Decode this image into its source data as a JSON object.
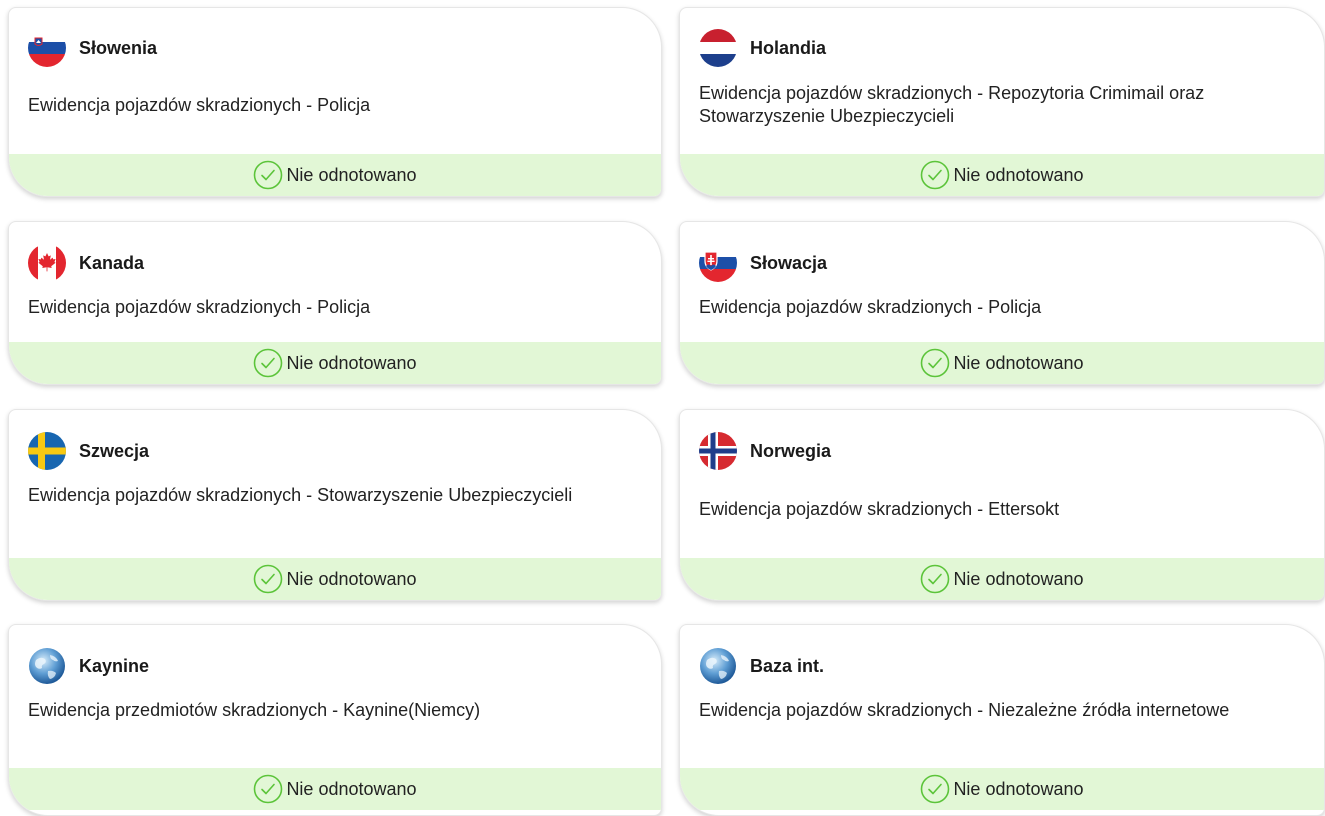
{
  "colors": {
    "status_bg": "#e2f7d6",
    "check_green": "#5cc43a",
    "card_border": "#e6e6e6"
  },
  "cards": [
    {
      "country": "Słowenia",
      "flag_icon": "slovenia-flag-icon",
      "description": "Ewidencja pojazdów skradzionych - Policja",
      "status": "Nie odnotowano"
    },
    {
      "country": "Holandia",
      "flag_icon": "netherlands-flag-icon",
      "description": "Ewidencja pojazdów skradzionych - Repozytoria Crimimail oraz Stowarzyszenie Ubezpieczycieli",
      "status": "Nie odnotowano"
    },
    {
      "country": "Kanada",
      "flag_icon": "canada-flag-icon",
      "description": "Ewidencja pojazdów skradzionych - Policja",
      "status": "Nie odnotowano"
    },
    {
      "country": "Słowacja",
      "flag_icon": "slovakia-flag-icon",
      "description": "Ewidencja pojazdów skradzionych - Policja",
      "status": "Nie odnotowano"
    },
    {
      "country": "Szwecja",
      "flag_icon": "sweden-flag-icon",
      "description": "Ewidencja pojazdów skradzionych - Stowarzyszenie Ubezpieczycieli",
      "status": "Nie odnotowano"
    },
    {
      "country": "Norwegia",
      "flag_icon": "norway-flag-icon",
      "description": "Ewidencja pojazdów skradzionych - Ettersokt",
      "status": "Nie odnotowano"
    },
    {
      "country": "Kaynine",
      "flag_icon": "globe-icon",
      "description": "Ewidencja przedmiotów skradzionych - Kaynine(Niemcy)",
      "status": "Nie odnotowano"
    },
    {
      "country": "Baza int.",
      "flag_icon": "globe-icon",
      "description": "Ewidencja pojazdów skradzionych - Niezależne źródła internetowe",
      "status": "Nie odnotowano"
    }
  ]
}
